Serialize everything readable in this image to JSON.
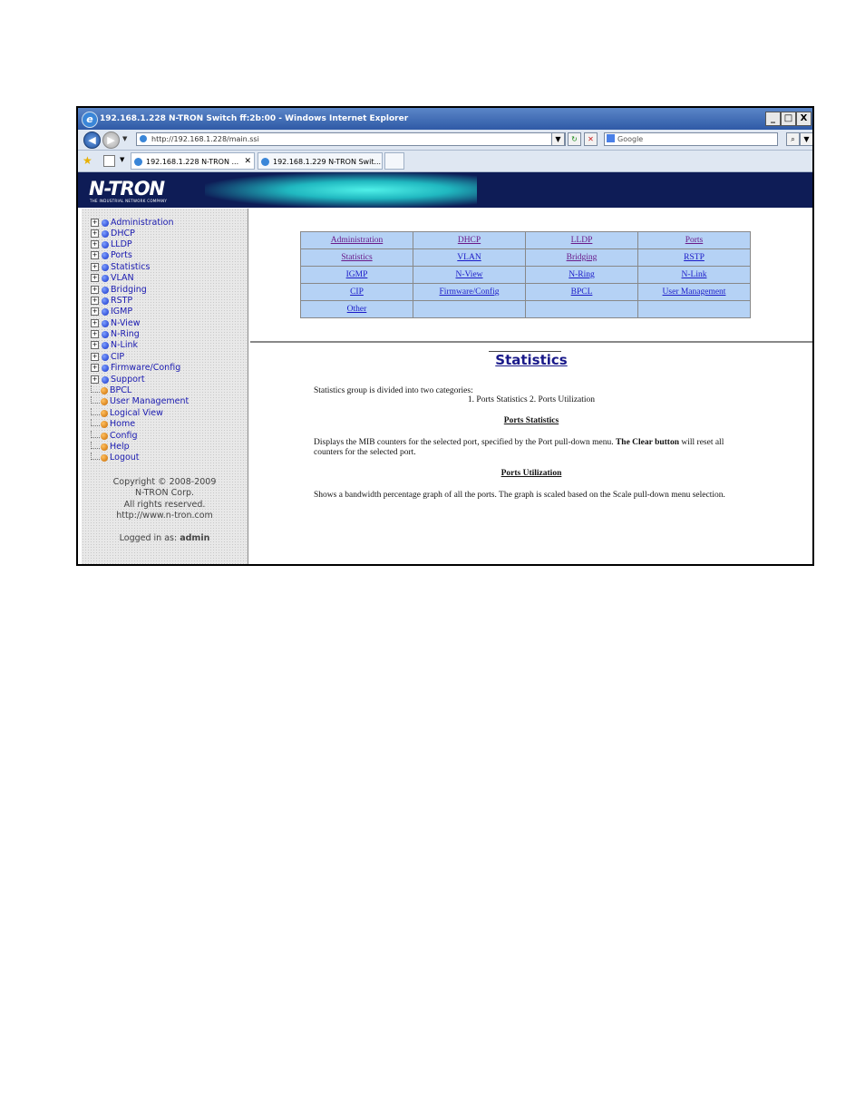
{
  "window": {
    "title": "192.168.1.228 N-TRON Switch ff:2b:00 - Windows Internet Explorer",
    "controls": [
      "_",
      "□",
      "X"
    ]
  },
  "address_bar": {
    "url": "http://192.168.1.228/main.ssi",
    "search_placeholder": "Google"
  },
  "tabs": [
    {
      "label": "192.168.1.228 N-TRON ..."
    },
    {
      "label": "192.168.1.229 N-TRON Swit..."
    }
  ],
  "banner": {
    "logo": "N-TRON",
    "tagline": "THE INDUSTRIAL NETWORK COMPANY"
  },
  "sidebar": {
    "expandable_items": [
      "Administration",
      "DHCP",
      "LLDP",
      "Ports",
      "Statistics",
      "VLAN",
      "Bridging",
      "RSTP",
      "IGMP",
      "N-View",
      "N-Ring",
      "N-Link",
      "CIP",
      "Firmware/Config",
      "Support"
    ],
    "leaf_items": [
      "BPCL",
      "User Management",
      "Logical View",
      "Home",
      "Config",
      "Help",
      "Logout"
    ],
    "copyright_lines": [
      "Copyright © 2008-2009",
      "N-TRON Corp.",
      "All rights reserved.",
      "http://www.n-tron.com"
    ],
    "logged_in_label": "Logged in as:",
    "logged_in_user": "admin"
  },
  "menu_table": [
    [
      "Administration",
      "DHCP",
      "LLDP",
      "Ports"
    ],
    [
      "Statistics",
      "VLAN",
      "Bridging",
      "RSTP"
    ],
    [
      "IGMP",
      "N-View",
      "N-Ring",
      "N-Link"
    ],
    [
      "CIP",
      "Firmware/Config",
      "BPCL",
      "User Management"
    ],
    [
      "Other",
      "",
      "",
      ""
    ]
  ],
  "content": {
    "title": "Statistics",
    "intro_line1": "Statistics group is divided into two categories:",
    "intro_line2": "1. Ports Statistics   2. Ports Utilization",
    "section1_heading": "Ports Statistics",
    "section1_text_a": "Displays the MIB counters for the selected port, specified by the Port pull-down menu. ",
    "section1_bold": "The Clear button",
    "section1_text_b": " will reset all counters for the selected port.",
    "section2_heading": "Ports Utilization",
    "section2_text": "Shows a bandwidth percentage graph of all the ports. The graph is scaled based on the Scale pull-down menu selection."
  },
  "colors": {
    "banner": "#0e1c56",
    "menu_cell": "#b5d2f5",
    "link": "#1a1ac8",
    "visited_link": "#6a1a8a",
    "title_blue": "#1a1a8a"
  }
}
